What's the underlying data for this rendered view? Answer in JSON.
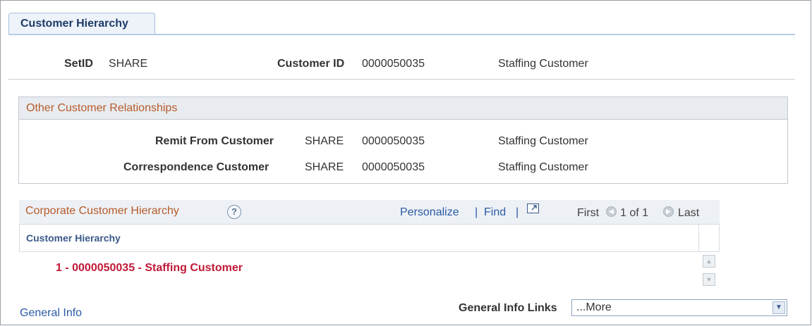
{
  "tab": {
    "label": "Customer Hierarchy"
  },
  "header": {
    "setid_label": "SetID",
    "setid_value": "SHARE",
    "customer_id_label": "Customer ID",
    "customer_id_value": "0000050035",
    "customer_name": "Staffing Customer"
  },
  "other_relationships": {
    "title": "Other Customer Relationships",
    "rows": [
      {
        "label": "Remit From Customer",
        "setid": "SHARE",
        "id": "0000050035",
        "name": "Staffing Customer"
      },
      {
        "label": "Correspondence Customer",
        "setid": "SHARE",
        "id": "0000050035",
        "name": "Staffing Customer"
      }
    ]
  },
  "hierarchy_grid": {
    "title": "Corporate Customer Hierarchy",
    "help_icon": "?",
    "personalize": "Personalize",
    "separator": "|",
    "find": "Find",
    "first": "First",
    "range": "1 of 1",
    "last": "Last",
    "column_header": "Customer Hierarchy",
    "rows": [
      {
        "text": "1 - 0000050035 - Staffing Customer"
      }
    ]
  },
  "footer": {
    "general_info_link": "General Info",
    "links_label": "General Info Links",
    "links_select_value": "...More"
  },
  "colors": {
    "section_title": "#b65b2a",
    "link": "#2a5ba6",
    "row_text": "#c01a37",
    "tab_text": "#1c3a66"
  }
}
